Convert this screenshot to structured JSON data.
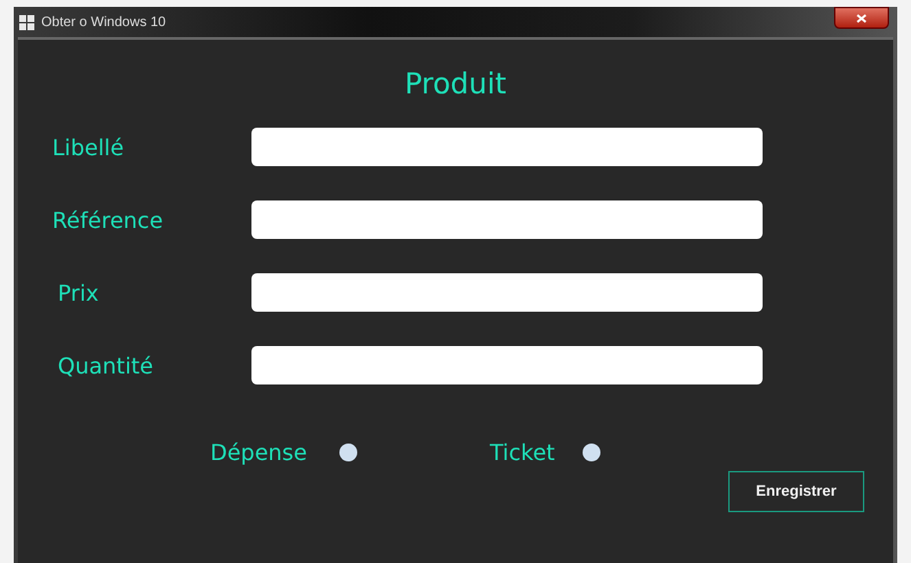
{
  "window": {
    "title": "Obter o Windows 10"
  },
  "form": {
    "title": "Produit",
    "fields": [
      {
        "label": "Libellé"
      },
      {
        "label": "Référence"
      },
      {
        "label": "Prix"
      },
      {
        "label": "Quantité"
      }
    ],
    "options": [
      {
        "label": "Dépense",
        "selected": false
      },
      {
        "label": "Ticket",
        "selected": false
      }
    ],
    "button": "Enregistrer"
  }
}
